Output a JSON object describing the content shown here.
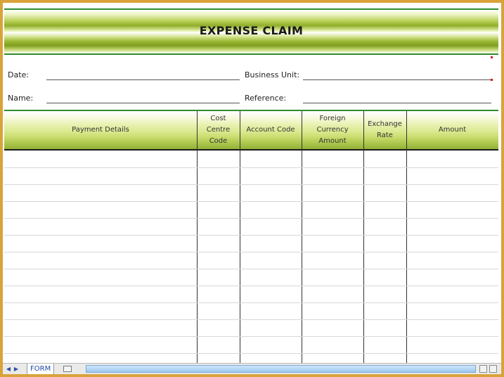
{
  "form": {
    "title": "EXPENSE CLAIM",
    "fields": {
      "date_label": "Date:",
      "name_label": "Name:",
      "business_unit_label": "Business Unit:",
      "reference_label": "Reference:"
    }
  },
  "table": {
    "columns": [
      "Payment Details",
      "Cost\nCentre\nCode",
      "Account Code",
      "Foreign\nCurrency\nAmount",
      "Exchange\nRate",
      "Amount"
    ]
  },
  "sheet_tabs": {
    "active": "FORM"
  },
  "colors": {
    "accent_green": "#2e8b2e",
    "header_olive": "#93b036",
    "frame_orange": "#d9a23a"
  }
}
